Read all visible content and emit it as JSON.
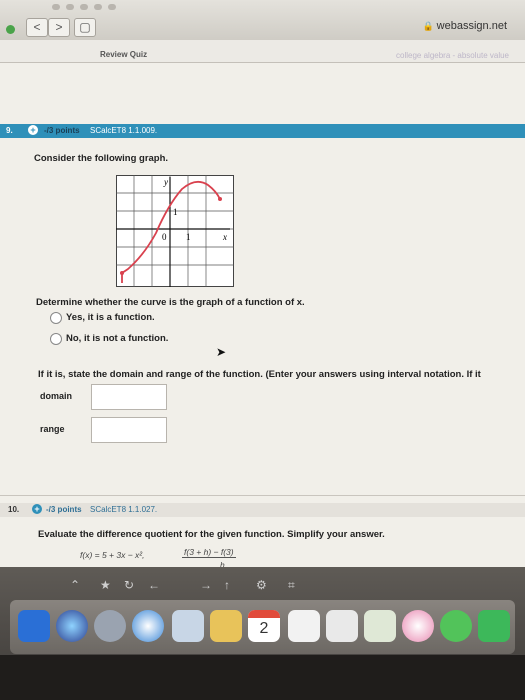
{
  "browser": {
    "url": "webassign.net",
    "nav_back": "<",
    "nav_forward": ">",
    "sidebar": "▢"
  },
  "header": {
    "review_quiz": "Review Quiz",
    "course": "college algebra - absolute value"
  },
  "question9": {
    "number": "9.",
    "points": "-/3 points",
    "code": "SCalcET8 1.1.009.",
    "prompt": "Consider the following graph.",
    "graph": {
      "y_label": "y",
      "x_label": "x",
      "origin_label": "0",
      "x_tick": "1",
      "y_tick": "1"
    },
    "determine": "Determine whether the curve is the graph of a function of x.",
    "option_yes": "Yes, it is a function.",
    "option_no": "No, it is not a function.",
    "instruction": "If it is, state the domain and range of the function. (Enter your answers using interval notation. If it",
    "domain_label": "domain",
    "range_label": "range"
  },
  "question10": {
    "number": "10.",
    "points": "-/3 points",
    "code": "SCalcET8 1.1.027.",
    "prompt": "Evaluate the difference quotient for the given function. Simplify your answer.",
    "function": "f(x) = 5 + 3x − x²,",
    "quotient_num": "f(3 + h) − f(3)",
    "quotient_den": "h"
  },
  "dock": {
    "calendar_day": "2"
  }
}
